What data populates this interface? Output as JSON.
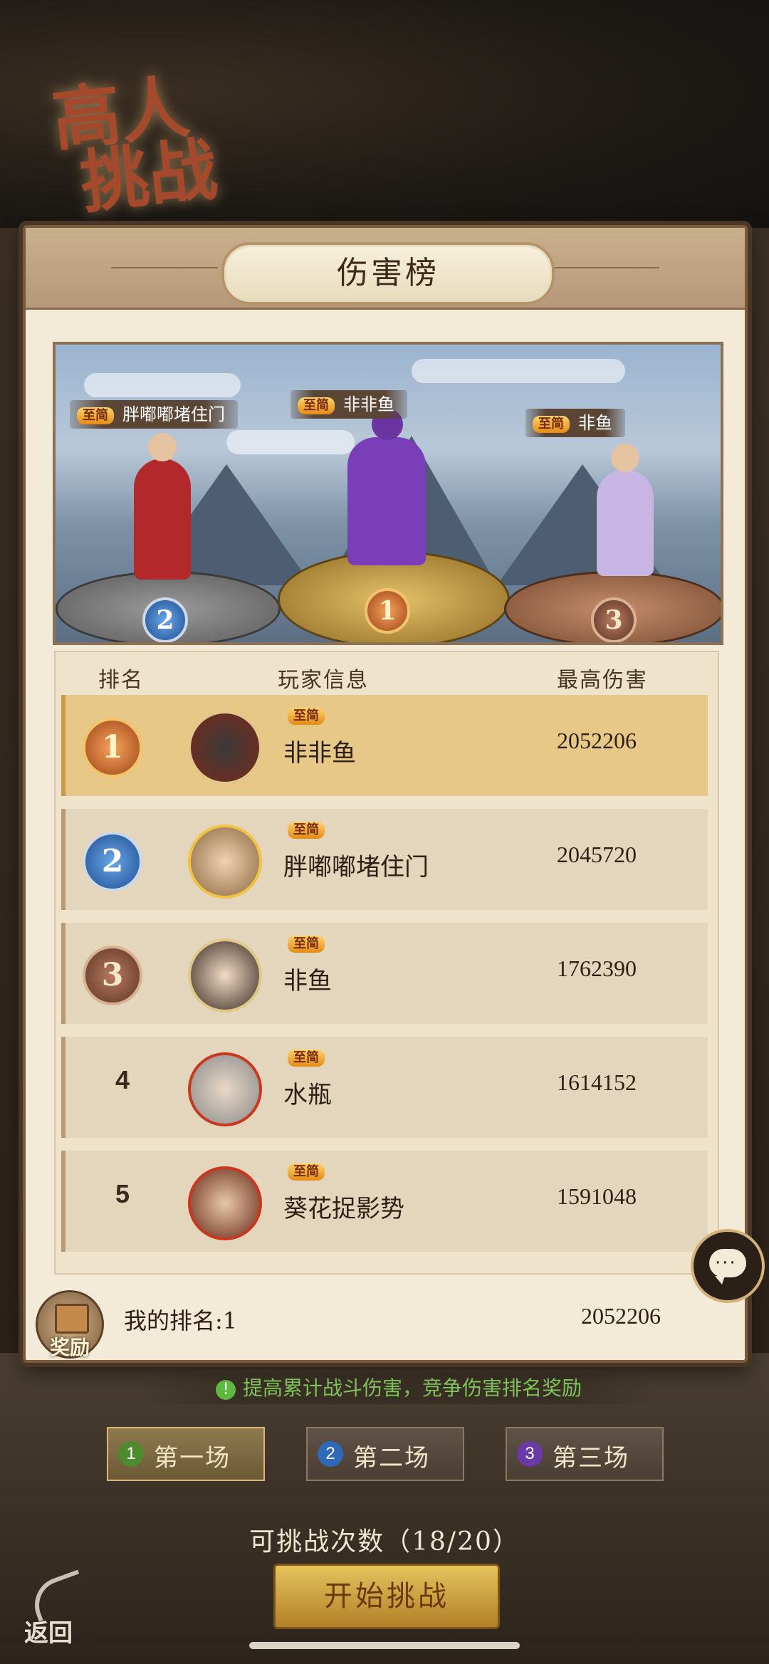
{
  "event": {
    "title_line1": "高人",
    "title_line2": "挑战"
  },
  "panel": {
    "title": "伤害榜"
  },
  "podium": [
    {
      "rank": "2",
      "vip": "至简",
      "name": "胖嘟嘟堵住门"
    },
    {
      "rank": "1",
      "vip": "至简",
      "name": "非非鱼"
    },
    {
      "rank": "3",
      "vip": "至简",
      "name": "非鱼"
    }
  ],
  "table": {
    "headers": {
      "rank": "排名",
      "player": "玩家信息",
      "damage": "最高伤害"
    },
    "rows": [
      {
        "rank": "1",
        "vip": "至简",
        "name": "非非鱼",
        "damage": "2052206"
      },
      {
        "rank": "2",
        "vip": "至简",
        "name": "胖嘟嘟堵住门",
        "damage": "2045720"
      },
      {
        "rank": "3",
        "vip": "至简",
        "name": "非鱼",
        "damage": "1762390"
      },
      {
        "rank": "4",
        "vip": "至简",
        "name": "水瓶",
        "damage": "1614152"
      },
      {
        "rank": "5",
        "vip": "至简",
        "name": "葵花捉影势",
        "damage": "1591048"
      }
    ]
  },
  "my_rank": {
    "reward_label": "奖励",
    "text": "我的排名:1",
    "damage": "2052206"
  },
  "hint": {
    "icon": "!",
    "text": "提高累计战斗伤害，竞争伤害排名奖励"
  },
  "stages": [
    {
      "num": "1",
      "label": "第一场",
      "color": "#4e8a2e"
    },
    {
      "num": "2",
      "label": "第二场",
      "color": "#2d6bb8"
    },
    {
      "num": "3",
      "label": "第三场",
      "color": "#6c3aa8"
    }
  ],
  "attempts": "可挑战次数（18/20）",
  "start_button": "开始挑战",
  "back_button": "返回"
}
